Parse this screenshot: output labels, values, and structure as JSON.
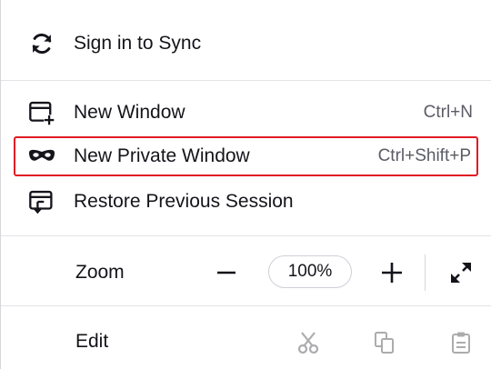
{
  "menu": {
    "sync": {
      "label": "Sign in to Sync",
      "icon": "sync-icon"
    },
    "new_window": {
      "label": "New Window",
      "shortcut": "Ctrl+N",
      "icon": "new-window-icon"
    },
    "private_window": {
      "label": "New Private Window",
      "shortcut": "Ctrl+Shift+P",
      "icon": "private-mask-icon",
      "highlight_color": "#e01b24"
    },
    "restore_session": {
      "label": "Restore Previous Session",
      "icon": "restore-session-icon"
    },
    "zoom": {
      "label": "Zoom",
      "value": "100%",
      "decrease_icon": "minus-icon",
      "increase_icon": "plus-icon",
      "fullscreen_icon": "fullscreen-expand-icon"
    },
    "edit": {
      "label": "Edit",
      "cut_icon": "scissors-icon",
      "copy_icon": "copy-icon",
      "paste_icon": "clipboard-icon"
    }
  }
}
